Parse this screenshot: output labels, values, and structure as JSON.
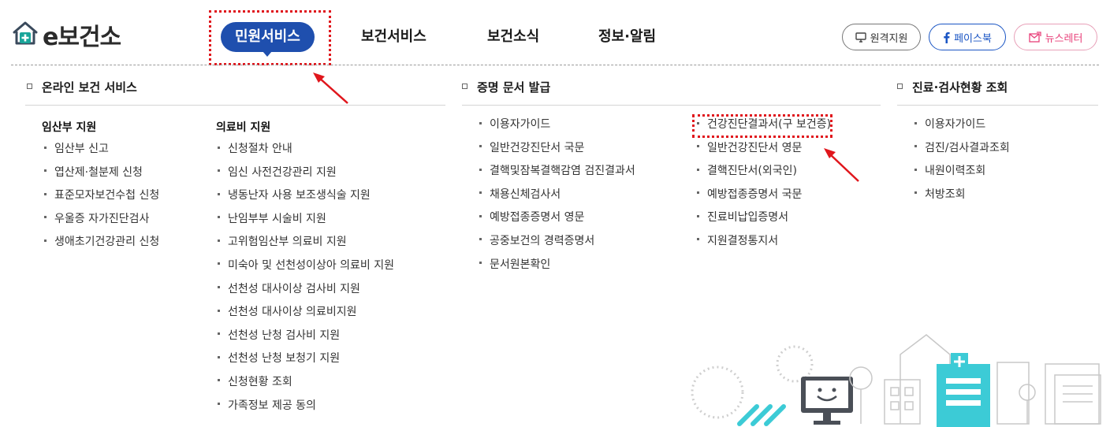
{
  "logo": {
    "text": "e보건소"
  },
  "gnb": [
    "민원서비스",
    "보건서비스",
    "보건소식",
    "정보·알림"
  ],
  "top_buttons": {
    "remote": "원격지원",
    "facebook": "페이스북",
    "newsletter": "뉴스레터"
  },
  "sections": {
    "online": {
      "title": "온라인 보건 서비스",
      "col1": {
        "title": "임산부 지원",
        "items": [
          "임산부 신고",
          "엽산제·철분제 신청",
          "표준모자보건수첩 신청",
          "우울증 자가진단검사",
          "생애초기건강관리 신청"
        ]
      },
      "col2": {
        "title": "의료비 지원",
        "items": [
          "신청절차 안내",
          "임신 사전건강관리 지원",
          "냉동난자 사용 보조생식술 지원",
          "난임부부 시술비 지원",
          "고위험임산부 의료비 지원",
          "미숙아 및 선천성이상아 의료비 지원",
          "선천성 대사이상 검사비 지원",
          "선천성 대사이상 의료비지원",
          "선천성 난청 검사비 지원",
          "선천성 난청 보청기 지원",
          "신청현황 조회",
          "가족정보 제공 동의"
        ]
      }
    },
    "docs": {
      "title": "증명 문서 발급",
      "col1": [
        "이용자가이드",
        "일반건강진단서 국문",
        "결핵및잠복결핵감염 검진결과서",
        "채용신체검사서",
        "예방접종증명서 영문",
        "공중보건의 경력증명서",
        "문서원본확인"
      ],
      "col2": [
        "건강진단결과서(구 보건증)",
        "일반건강진단서 영문",
        "결핵진단서(외국인)",
        "예방접종증명서 국문",
        "진료비납입증명서",
        "지원결정통지서"
      ]
    },
    "status": {
      "title": "진료·검사현황 조회",
      "items": [
        "이용자가이드",
        "검진/검사결과조회",
        "내원이력조회",
        "처방조회"
      ]
    }
  },
  "colors": {
    "brand_blue": "#1f4fae",
    "highlight_red": "#e0161c",
    "facebook_blue": "#1a55c4",
    "newsletter_pink": "#e8407a",
    "logo_teal": "#1aa59a"
  }
}
